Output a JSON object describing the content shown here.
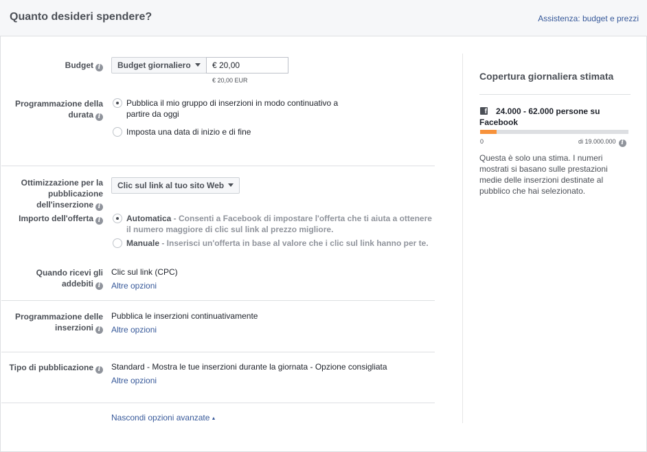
{
  "header": {
    "title": "Quanto desideri spendere?",
    "help_link": "Assistenza: budget e prezzi"
  },
  "budget": {
    "label": "Budget",
    "type_dropdown": "Budget giornaliero",
    "amount": "€ 20,00",
    "amount_note": "€ 20,00 EUR"
  },
  "schedule": {
    "label_line1": "Programmazione della",
    "label_line2": "durata",
    "option1_line1": "Pubblica il mio gruppo di inserzioni in modo continuativo a",
    "option1_line2": "partire da oggi",
    "option1_selected": true,
    "option2": "Imposta una data di inizio e di fine"
  },
  "optimization": {
    "label_line1": "Ottimizzazione per la",
    "label_line2": "pubblicazione",
    "label_line3": "dell'inserzione",
    "dropdown": "Clic sul link al tuo sito Web"
  },
  "bid": {
    "label": "Importo dell'offerta",
    "auto_title": "Automatica",
    "auto_desc_line1": " - Consenti a Facebook di impostare l'offerta che ti aiuta a ottenere",
    "auto_desc_line2": "il numero maggiore di clic sul link al prezzo migliore.",
    "manual_title": "Manuale",
    "manual_desc": " - Inserisci un'offerta in base al valore che i clic sul link hanno per te."
  },
  "charged": {
    "label_line1": "Quando ricevi gli",
    "label_line2": "addebiti",
    "value": "Clic sul link (CPC)",
    "more": "Altre opzioni"
  },
  "ad_schedule": {
    "label_line1": "Programmazione delle",
    "label_line2": "inserzioni",
    "value": "Pubblica le inserzioni continuativamente",
    "more": "Altre opzioni"
  },
  "delivery": {
    "label": "Tipo di pubblicazione",
    "value": "Standard - Mostra le tue inserzioni durante la giornata - Opzione consigliata",
    "more": "Altre opzioni"
  },
  "advanced_toggle": "Nascondi opzioni avanzate",
  "reach_panel": {
    "title": "Copertura giornaliera stimata",
    "estimate": "24.000 - 62.000 persone su Facebook",
    "bar_fill_fraction": 0.11,
    "min_label": "0",
    "max_label": "di 19.000.000",
    "note": "Questa è solo una stima. I numeri mostrati si basano sulle prestazioni medie delle inserzioni destinate al pubblico che hai selezionato."
  },
  "colors": {
    "link": "#365899",
    "bar_fill": "#f7923b",
    "header_bg": "#f6f7f9"
  },
  "icons": [
    "info-icon",
    "caret-down-icon",
    "facebook-icon",
    "caret-up-icon"
  ]
}
